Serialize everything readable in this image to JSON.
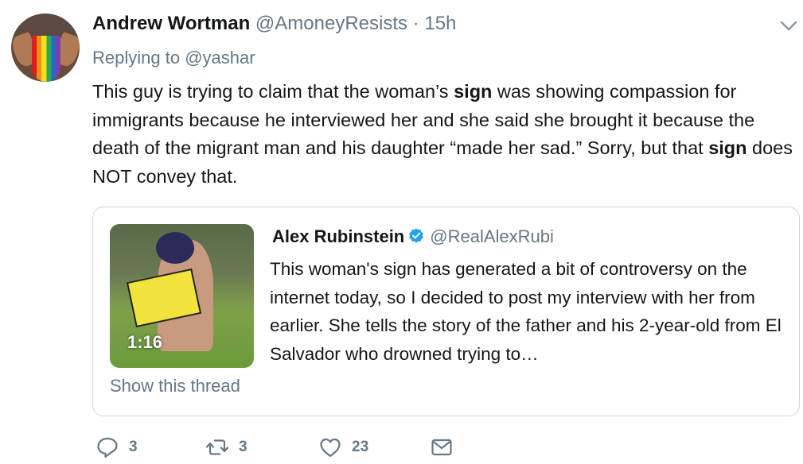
{
  "tweet": {
    "display_name": "Andrew Wortman",
    "handle": "@AmoneyResists",
    "separator": "·",
    "time": "15h",
    "replying_prefix": "Replying to ",
    "replying_to": "@yashar",
    "text_parts": [
      "This guy is trying to claim that the woman’s ",
      "sign",
      " was showing compassion for immigrants because he interviewed her and she said she brought it because the death of the migrant man and his daughter “made her sad.” Sorry, but that ",
      "sign",
      " does NOT convey that."
    ]
  },
  "quote": {
    "display_name": "Alex Rubinstein",
    "handle": "@RealAlexRubi",
    "text": "This woman's sign has generated a bit of controversy on the internet today, so I decided to post my interview with her from earlier. She tells the story of the father and his 2-year-old from El Salvador who drowned trying to…",
    "video_duration": "1:16",
    "show_thread": "Show this thread"
  },
  "actions": {
    "replies": "3",
    "retweets": "3",
    "likes": "23"
  },
  "colors": {
    "text": "#14171a",
    "muted": "#657786",
    "verified": "#1da1f2",
    "border": "#ccd6dd"
  },
  "icons": [
    "chevron-down-icon",
    "verified-badge-icon",
    "reply-icon",
    "retweet-icon",
    "like-icon",
    "direct-message-icon",
    "play-video-thumbnail"
  ]
}
